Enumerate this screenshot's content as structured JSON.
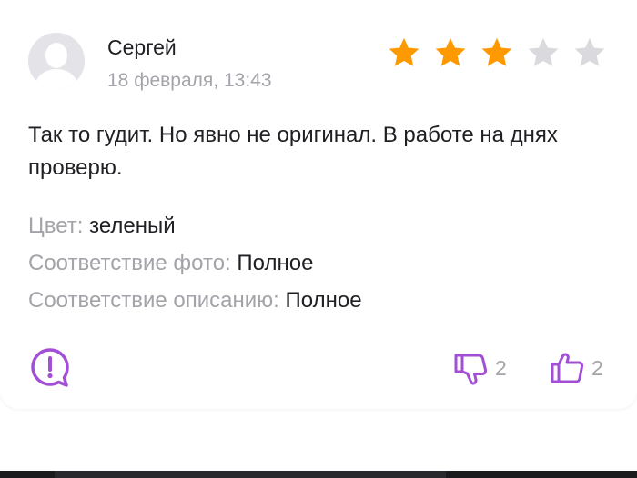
{
  "review": {
    "author": "Сергей",
    "date": "18 февраля, 13:43",
    "rating": 3,
    "rating_max": 5,
    "text": "Так то гудит. Но явно не оригинал. В работе на днях проверю.",
    "attributes": [
      {
        "label": "Цвет:",
        "value": "зеленый"
      },
      {
        "label": "Соответствие фото:",
        "value": "Полное"
      },
      {
        "label": "Соответствие описанию:",
        "value": "Полное"
      }
    ],
    "dislike_count": "2",
    "like_count": "2"
  },
  "colors": {
    "star_filled": "#ff9900",
    "star_empty": "#d9d9de",
    "accent_purple": "#a24fd6",
    "muted_text": "#a3a3a9"
  },
  "icons": {
    "report": "report-icon",
    "dislike": "thumbs-down-icon",
    "like": "thumbs-up-icon"
  }
}
